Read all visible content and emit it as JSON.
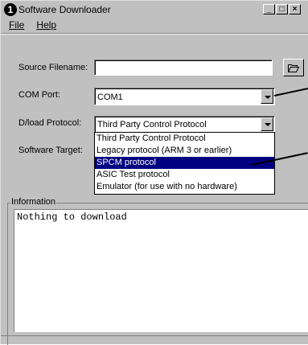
{
  "window": {
    "title": "Software Downloader",
    "app_icon_glyph": "1",
    "minimize_glyph": "_",
    "maximize_glyph": "□",
    "close_glyph": "×"
  },
  "menu": {
    "file": "File",
    "help": "Help"
  },
  "form": {
    "source_filename_label": "Source Filename:",
    "source_filename_value": "",
    "com_port_label": "COM Port:",
    "com_port_value": "COM1",
    "dload_protocol_label": "D/load Protocol:",
    "dload_protocol_value": "Third Party Control Protocol",
    "software_target_label": "Software Target:"
  },
  "dropdown": {
    "options": [
      "Third Party Control Protocol",
      "Legacy protocol (ARM 3 or earlier)",
      "SPCM protocol",
      "ASIC Test protocol",
      "Emulator (for use with no hardware)"
    ],
    "selected_index": 2
  },
  "information": {
    "title": "Information",
    "text": "Nothing to download"
  },
  "icons": {
    "browse": "folder-open-icon",
    "dropdown": "chevron-down-icon"
  }
}
